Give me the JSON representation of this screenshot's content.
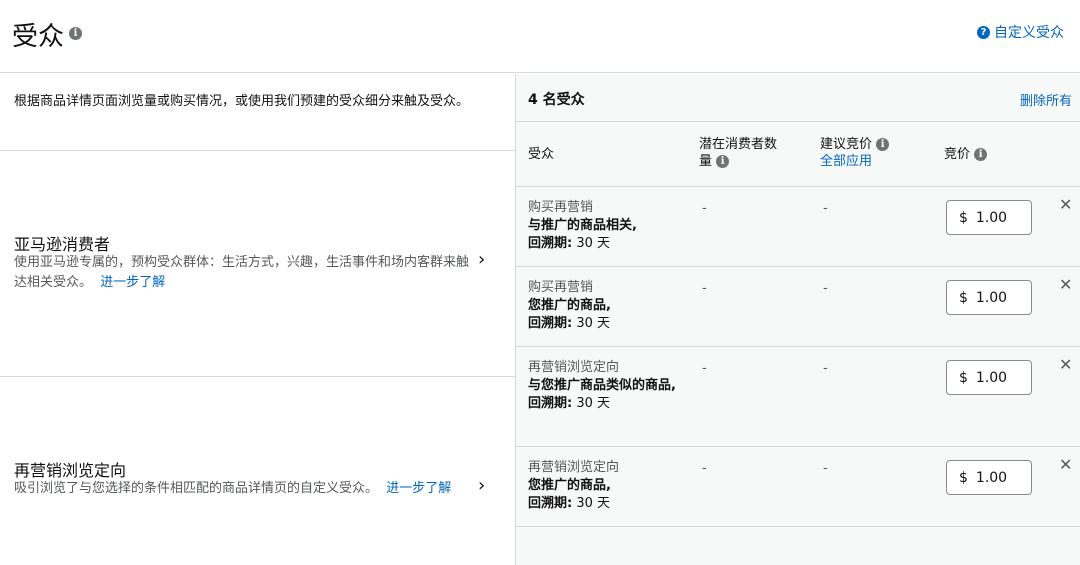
{
  "header": {
    "title": "受众",
    "title_info": "i",
    "help_icon": "?",
    "help_link": "自定义受众"
  },
  "left": {
    "description": "根据商品详情页面浏览量或购买情况，或使用我们预建的受众细分来触及受众。",
    "options": [
      {
        "title": "亚马逊消费者",
        "desc": "使用亚马逊专属的，预构受众群体：生活方式，兴趣，生活事件和场内客群来触达相关受众。",
        "link": "进一步了解",
        "chevron": "›"
      },
      {
        "title": "再营销浏览定向",
        "desc": "吸引浏览了与您选择的条件相匹配的商品详情页的自定义受众。",
        "link": "进一步了解",
        "chevron": "›"
      }
    ]
  },
  "right": {
    "count": "4 名受众",
    "remove_all": "删除所有",
    "columns": {
      "audience": "受众",
      "potential": "潜在消费者数量",
      "suggested": "建议竞价",
      "apply_all": "全部应用",
      "bid": "竞价"
    },
    "rows": [
      {
        "type": "购买再营销",
        "target": "与推广的商品相关,",
        "lookback_label": "回溯期:",
        "lookback_value": "30 天",
        "potential": "-",
        "suggested": "-",
        "currency": "$",
        "bid": "1.00",
        "close": "✕"
      },
      {
        "type": "购买再营销",
        "target": "您推广的商品,",
        "lookback_label": "回溯期:",
        "lookback_value": "30 天",
        "potential": "-",
        "suggested": "-",
        "currency": "$",
        "bid": "1.00",
        "close": "✕"
      },
      {
        "type": "再营销浏览定向",
        "target": "与您推广商品类似的商品,",
        "lookback_label": "回溯期:",
        "lookback_value": "30 天",
        "potential": "-",
        "suggested": "-",
        "currency": "$",
        "bid": "1.00",
        "close": "✕"
      },
      {
        "type": "再营销浏览定向",
        "target": "您推广的商品,",
        "lookback_label": "回溯期:",
        "lookback_value": "30 天",
        "potential": "-",
        "suggested": "-",
        "currency": "$",
        "bid": "1.00",
        "close": "✕"
      }
    ]
  }
}
